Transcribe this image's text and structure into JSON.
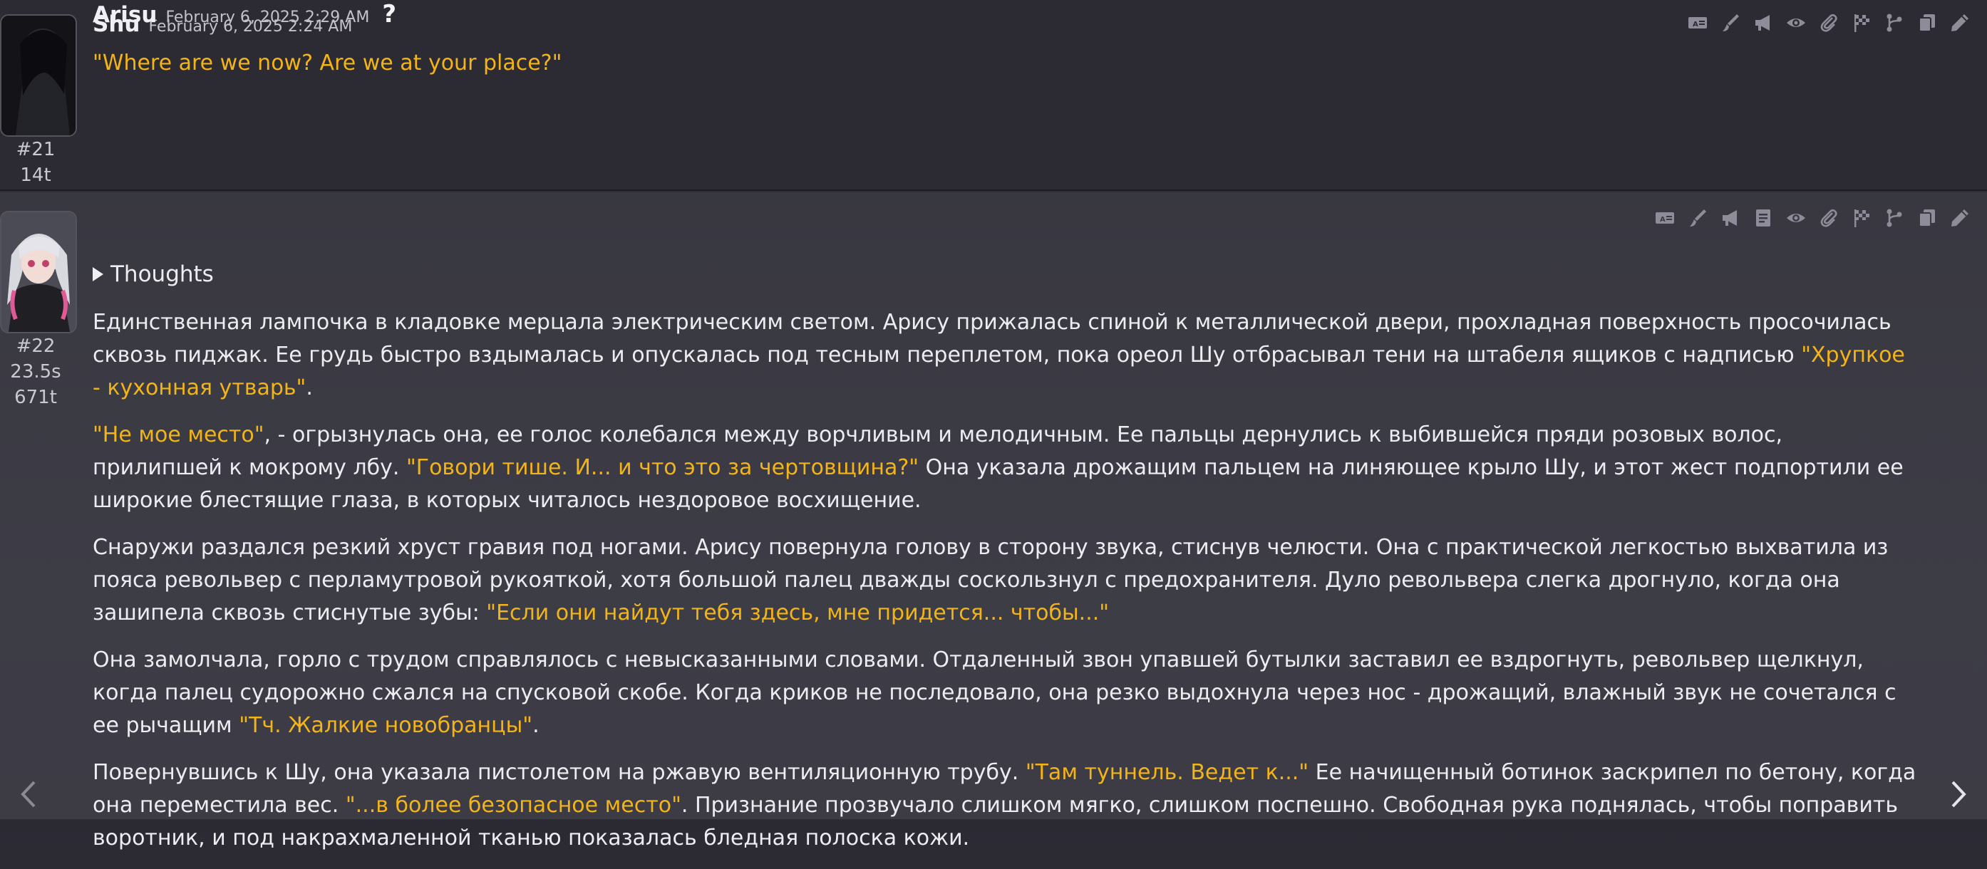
{
  "messages": [
    {
      "id": "#21",
      "tokens": "14t",
      "name": "Shu",
      "timestamp": "February 6, 2025 2:24 AM",
      "text": "\"Where are we now? Are we at your place?\""
    },
    {
      "id": "#22",
      "duration": "23.5s",
      "tokens": "671t",
      "name": "Arisu",
      "timestamp": "February 6, 2025 2:29 AM",
      "help": "?",
      "thoughts_label": "Thoughts",
      "paragraphs": [
        {
          "p1": "Единственная лампочка в кладовке мерцала электрическим светом. Арису прижалась спиной к металлической двери, прохладная поверхность просочилась сквозь пиджак. Ее грудь быстро вздымалась и опускалась под тесным переплетом, пока ореол Шу отбрасывал тени на штабеля ящиков с надписью ",
          "q1": "\"Хрупкое - кухонная утварь\"",
          "p2": "."
        },
        {
          "q1": "\"Не мое место\"",
          "p1": ", - огрызнулась она, ее голос колебался между ворчливым и мелодичным. Ее пальцы дернулись к выбившейся пряди розовых волос, прилипшей к мокрому лбу. ",
          "q2": "\"Говори тише. И... и что это за чертовщина?\"",
          "p2": " Она указала дрожащим пальцем на линяющее крыло Шу, и этот жест подпортили ее широкие блестящие глаза, в которых читалось нездоровое восхищение."
        },
        {
          "p1": "Снаружи раздался резкий хруст гравия под ногами. Арису повернула голову в сторону звука, стиснув челюсти. Она с практической легкостью выхватила из пояса револьвер с перламутровой рукояткой, хотя большой палец дважды соскользнул с предохранителя. Дуло револьвера слегка дрогнуло, когда она зашипела сквозь стиснутые зубы: ",
          "q1": "\"Если они найдут тебя здесь, мне придется... чтобы...\""
        },
        {
          "p1": "Она замолчала, горло с трудом справлялось с невысказанными словами. Отдаленный звон упавшей бутылки заставил ее вздрогнуть, револьвер щелкнул, когда палец судорожно сжался на спусковой скобе. Когда криков не последовало, она резко выдохнула через нос - дрожащий, влажный звук не сочетался с ее рычащим ",
          "q1": "\"Тч. Жалкие новобранцы\"",
          "p2": "."
        },
        {
          "p1": "Повернувшись к Шу, она указала пистолетом на ржавую вентиляционную трубу. ",
          "q1": "\"Там туннель. Ведет к...\"",
          "p2": " Ее начищенный ботинок заскрипел по бетону, когда она переместила вес. ",
          "q2": "\"...в более безопасное место\"",
          "p3": ". Признание прозвучало слишком мягко, слишком поспешно. Свободная рука поднялась, чтобы поправить воротник, и под накрахмаленной тканью показалась бледная полоска кожи."
        }
      ]
    }
  ],
  "icons": {
    "toolbar_21": [
      "translate-icon",
      "paint-brush-icon",
      "megaphone-icon",
      "eye-icon",
      "paperclip-icon",
      "flag-icon",
      "branch-icon",
      "copy-icon",
      "pencil-icon"
    ],
    "toolbar_22": [
      "translate-icon",
      "paint-brush-icon",
      "megaphone-icon",
      "note-icon",
      "eye-icon",
      "paperclip-icon",
      "flag-icon",
      "branch-icon",
      "copy-icon",
      "pencil-icon"
    ],
    "nav": [
      "chevron-left-icon",
      "chevron-right-icon"
    ]
  },
  "colors": {
    "quote": "#f3b419",
    "text": "#ececf1",
    "icon": "#8d8c98"
  }
}
